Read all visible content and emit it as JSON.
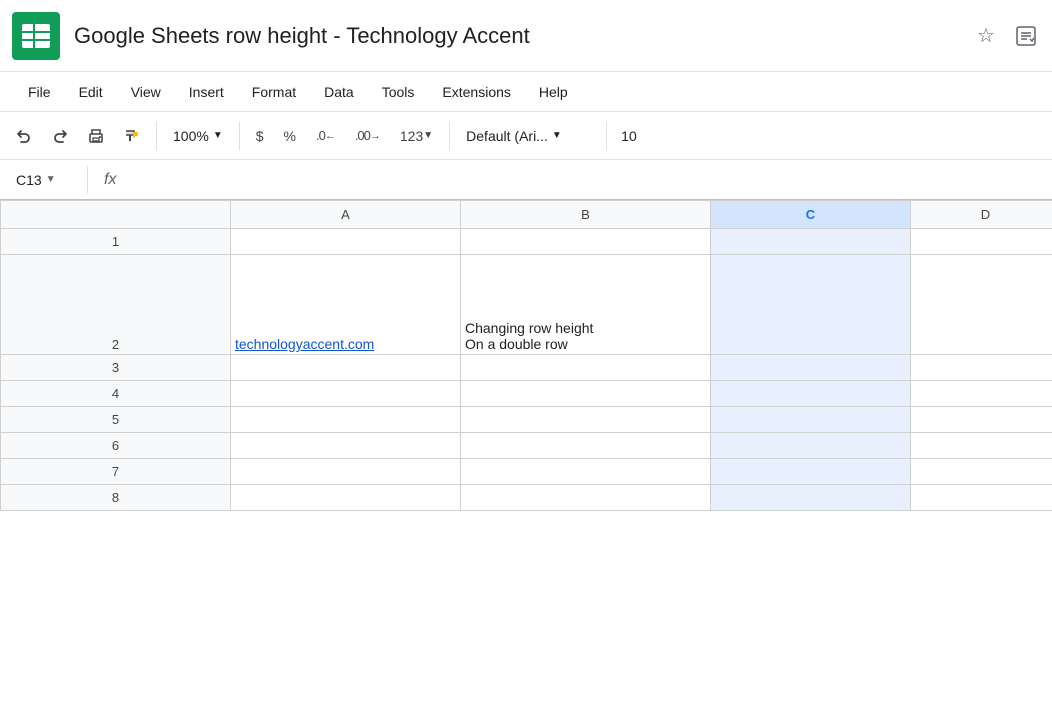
{
  "title": "Google Sheets row height - Technology Accent",
  "appIcon": {
    "color": "#0f9d58",
    "symbol": "▦"
  },
  "titleIcons": [
    {
      "name": "star-icon",
      "symbol": "☆"
    },
    {
      "name": "folder-icon",
      "symbol": "⬜"
    }
  ],
  "menuBar": {
    "items": [
      {
        "id": "file",
        "label": "File"
      },
      {
        "id": "edit",
        "label": "Edit"
      },
      {
        "id": "view",
        "label": "View"
      },
      {
        "id": "insert",
        "label": "Insert"
      },
      {
        "id": "format",
        "label": "Format"
      },
      {
        "id": "data",
        "label": "Data"
      },
      {
        "id": "tools",
        "label": "Tools"
      },
      {
        "id": "extensions",
        "label": "Extensions"
      },
      {
        "id": "help",
        "label": "Help"
      }
    ]
  },
  "toolbar": {
    "zoom": "100%",
    "currency": "$",
    "percent": "%",
    "decimal_decrease": ".0",
    "decimal_increase": ".00",
    "format_number": "123",
    "font_name": "Default (Ari...",
    "font_size": "10"
  },
  "formulaBar": {
    "cellRef": "C13",
    "formula": ""
  },
  "columns": [
    "A",
    "B",
    "C",
    "D"
  ],
  "selectedColumn": "C",
  "rows": [
    {
      "rowNum": "1",
      "cells": [
        "",
        "",
        "",
        ""
      ],
      "height": "normal"
    },
    {
      "rowNum": "2",
      "cells": [
        {
          "type": "link",
          "text": "technologyaccent.com"
        },
        {
          "type": "multiline",
          "line1": "Changing row height",
          "line2": "On a double row"
        },
        {
          "type": "text",
          "text": ""
        },
        {
          "type": "text",
          "text": ""
        }
      ],
      "height": "tall"
    },
    {
      "rowNum": "3",
      "cells": [
        "",
        "",
        "",
        ""
      ],
      "height": "normal"
    },
    {
      "rowNum": "4",
      "cells": [
        "",
        "",
        "",
        ""
      ],
      "height": "normal"
    },
    {
      "rowNum": "5",
      "cells": [
        "",
        "",
        "",
        ""
      ],
      "height": "normal"
    },
    {
      "rowNum": "6",
      "cells": [
        "",
        "",
        "",
        ""
      ],
      "height": "normal"
    },
    {
      "rowNum": "7",
      "cells": [
        "",
        "",
        "",
        ""
      ],
      "height": "normal"
    },
    {
      "rowNum": "8",
      "cells": [
        "",
        "",
        "",
        ""
      ],
      "height": "normal"
    }
  ]
}
